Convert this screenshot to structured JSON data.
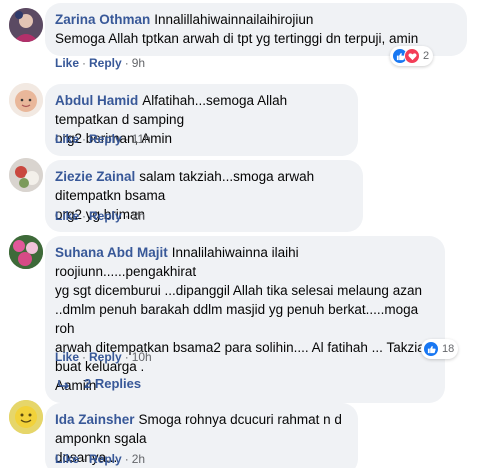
{
  "comments": [
    {
      "author": "Zarina Othman",
      "text": "Innalillahiwainnailaihirojiun\nSemoga Allah tptkan arwah di tpt yg tertinggi dn terpuji, amin",
      "like": "Like",
      "reply": "Reply",
      "time": "9h",
      "reaction_count": "2"
    },
    {
      "author": "Abdul Hamid",
      "text": "Alfatihah...semoga Allah tempatkan d samping\norg2 beriman, Amin",
      "like": "Like",
      "reply": "Reply",
      "time": "11h"
    },
    {
      "author": "Ziezie Zainal",
      "text": "salam takziah...smoga arwah ditempatkn bsama\norg2 yg briman",
      "like": "Like",
      "reply": "Reply",
      "time": "2h"
    },
    {
      "author": "Suhana Abd Majit",
      "text": "Innalilahiwainna ilaihi roojiunn......pengakhirat\nyg sgt dicemburui ...dipanggil Allah tika selesai melaung azan\n..dmlm penuh barakah ddlm masjid yg penuh berkat.....moga roh\narwah ditempatkan bsama2 para solihin.... Al fatihah ... Takziah\nbuat keluarga .\nAamiin",
      "like": "Like",
      "reply": "Reply",
      "time": "10h",
      "reaction_count": "18"
    },
    {
      "author": "Ida Zainsher",
      "text": "Smoga rohnya dcucuri rahmat n d amponkn sgala\ndosanya...",
      "like": "Like",
      "reply": "Reply",
      "time": "2h"
    }
  ],
  "replies_link": "2 Replies",
  "colors": {
    "link": "#385898",
    "bubble": "#f0f2f5",
    "like_blue": "#1877f2",
    "love_red": "#f33e58"
  }
}
